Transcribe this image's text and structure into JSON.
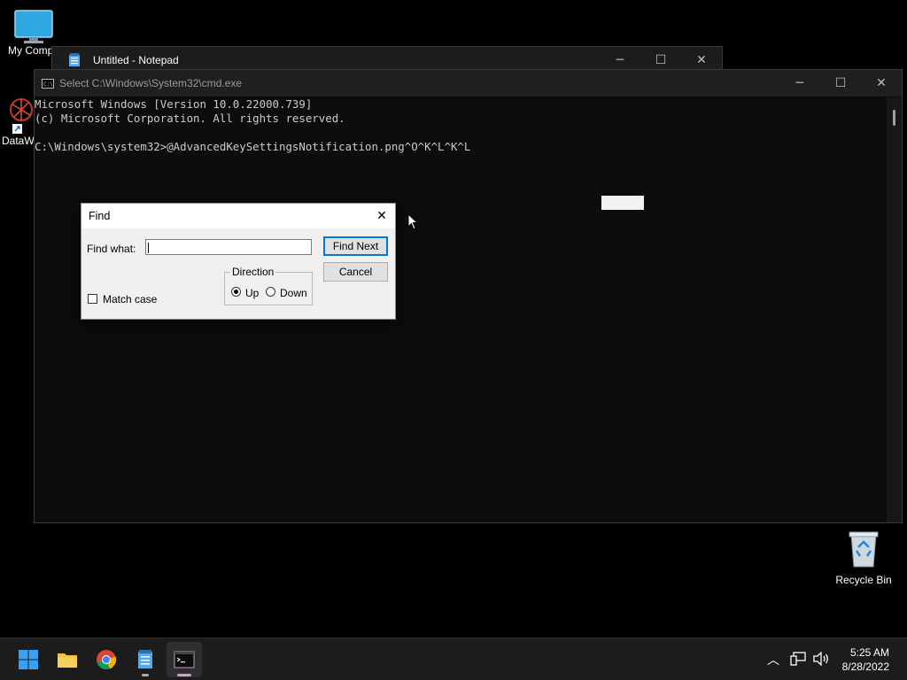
{
  "desktop": {
    "icons": [
      {
        "label": "My Compu"
      },
      {
        "label": "DataW"
      },
      {
        "label": "Recycle Bin"
      }
    ]
  },
  "notepad": {
    "title": "Untitled - Notepad"
  },
  "cmd": {
    "title": "Select C:\\Windows\\System32\\cmd.exe",
    "lines": [
      "Microsoft Windows [Version 10.0.22000.739]",
      "(c) Microsoft Corporation. All rights reserved.",
      "",
      "C:\\Windows\\system32>@AdvancedKeySettingsNotification.png^O^K^L^K^L"
    ]
  },
  "find_dialog": {
    "title": "Find",
    "find_what_label": "Find what:",
    "find_what_value": "",
    "find_next_label": "Find Next",
    "cancel_label": "Cancel",
    "direction_label": "Direction",
    "up_label": "Up",
    "down_label": "Down",
    "selected_direction": "Up",
    "match_case_label": "Match case",
    "match_case_checked": false
  },
  "taskbar": {
    "apps": [
      "start-icon",
      "file-explorer-icon",
      "chrome-icon",
      "notepad-icon",
      "cmd-icon"
    ],
    "time": "5:25 AM",
    "date": "8/28/2022"
  }
}
